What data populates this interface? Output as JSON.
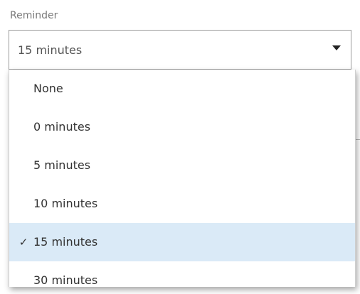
{
  "reminder": {
    "label": "Reminder",
    "selected_value": "15 minutes",
    "options": [
      {
        "label": "None",
        "selected": false
      },
      {
        "label": "0 minutes",
        "selected": false
      },
      {
        "label": "5 minutes",
        "selected": false
      },
      {
        "label": "10 minutes",
        "selected": false
      },
      {
        "label": "15 minutes",
        "selected": true
      },
      {
        "label": "30 minutes",
        "selected": false
      }
    ],
    "selected_check": "✓"
  },
  "colors": {
    "selected_background": "#daeaf7",
    "border": "#9a9a9a"
  },
  "icons": {
    "dropdown_arrow": "chevron-down-icon",
    "selected_marker": "checkmark-icon"
  }
}
